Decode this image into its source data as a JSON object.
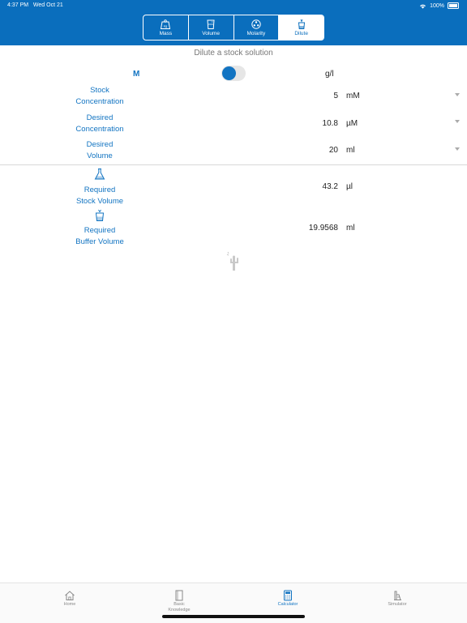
{
  "status_bar": {
    "time": "4:37 PM",
    "date": "Wed Oct 21",
    "battery": "100%"
  },
  "segments": [
    {
      "label": "Mass",
      "icon": "scale-icon"
    },
    {
      "label": "Volume",
      "icon": "beaker-icon"
    },
    {
      "label": "Molarity",
      "icon": "molecule-icon"
    },
    {
      "label": "Dilute",
      "icon": "dilute-cup-icon",
      "selected": true
    }
  ],
  "subtitle": "Dilute a stock solution",
  "toggle": {
    "left_label": "M",
    "right_label": "g/l",
    "state": "M"
  },
  "inputs": [
    {
      "label_line1": "Stock",
      "label_line2": "Concentration",
      "value": "5",
      "unit": "mM"
    },
    {
      "label_line1": "Desired",
      "label_line2": "Concentration",
      "value": "10.8",
      "unit": "µM"
    },
    {
      "label_line1": "Desired",
      "label_line2": "Volume",
      "value": "20",
      "unit": "ml"
    }
  ],
  "results": [
    {
      "label_line1": "Required",
      "label_line2": "Stock Volume",
      "value": "43.2",
      "unit": "µl",
      "icon": "flask-icon"
    },
    {
      "label_line1": "Required",
      "label_line2": "Buffer Volume",
      "value": "19.9568",
      "unit": "ml",
      "icon": "cup-icon"
    }
  ],
  "tabs": [
    {
      "label": "Home",
      "icon": "home-icon"
    },
    {
      "label_line1": "Basic",
      "label_line2": "Knowledge",
      "icon": "book-icon"
    },
    {
      "label": "Calculator",
      "icon": "calculator-icon",
      "selected": true
    },
    {
      "label": "Simulator",
      "icon": "simulator-icon"
    }
  ],
  "colors": {
    "accent": "#0a6ebd",
    "label": "#1274c2"
  }
}
